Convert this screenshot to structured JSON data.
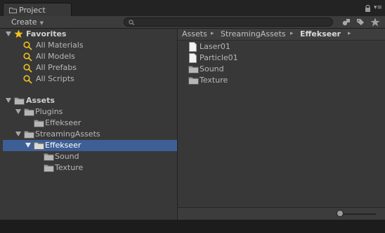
{
  "window": {
    "tab_title": "Project",
    "menu_glyph": "▾≡"
  },
  "toolbar": {
    "create_label": "Create",
    "create_arrow": "▼",
    "search_value": ""
  },
  "tree": {
    "favorites_label": "Favorites",
    "favorites": [
      {
        "label": "All Materials"
      },
      {
        "label": "All Models"
      },
      {
        "label": "All Prefabs"
      },
      {
        "label": "All Scripts"
      }
    ],
    "assets_label": "Assets",
    "plugins_label": "Plugins",
    "plugins_effekseer_label": "Effekseer",
    "streaming_label": "StreamingAssets",
    "effekseer_label": "Effekseer",
    "sound_label": "Sound",
    "texture_label": "Texture"
  },
  "breadcrumb": {
    "items": [
      "Assets",
      "StreamingAssets",
      "Effekseer"
    ],
    "separator": "▸"
  },
  "files": [
    {
      "label": "Laser01",
      "icon": "file-icon"
    },
    {
      "label": "Particle01",
      "icon": "file-icon"
    },
    {
      "label": "Sound",
      "icon": "folder-icon"
    },
    {
      "label": "Texture",
      "icon": "folder-icon"
    }
  ],
  "colors": {
    "selection": "#3e5f96",
    "star": "#f0c020",
    "search_glyph": "#e8c020"
  }
}
